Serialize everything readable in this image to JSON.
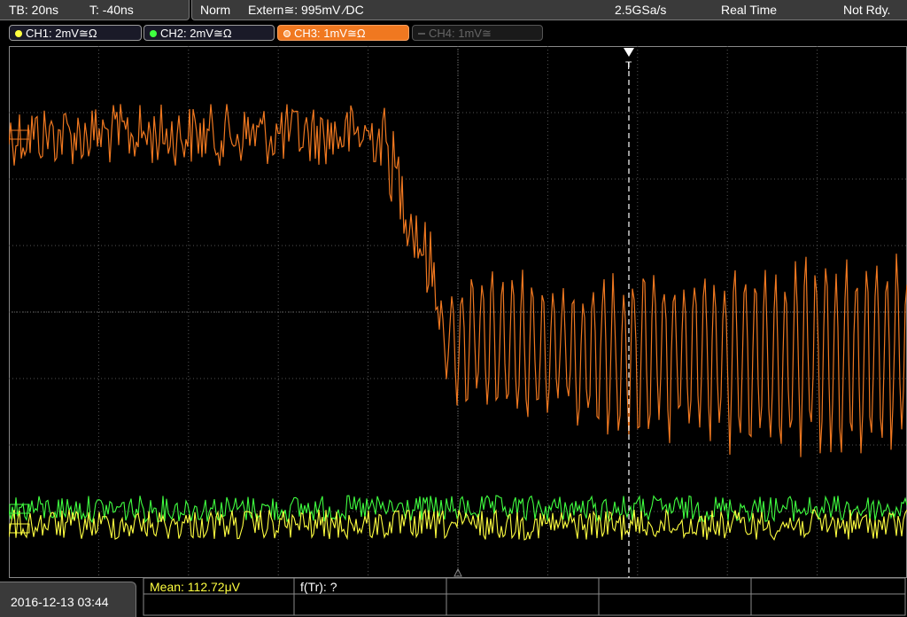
{
  "header": {
    "timebase": "TB: 20ns",
    "trigger_time": "T: -40ns",
    "mode": "Norm",
    "trigger": "Extern≅: 995mV ⁄DC",
    "sample_rate": "2.5GSa/s",
    "acq_mode": "Real Time",
    "status": "Not Rdy."
  },
  "channels": [
    {
      "label": "CH1: 2mV≅Ω",
      "color": "#ffff40",
      "active": true
    },
    {
      "label": "CH2: 2mV≅Ω",
      "color": "#40ff40",
      "active": true
    },
    {
      "label": "CH3: 1mV≅Ω",
      "color": "#f07820",
      "active": true
    },
    {
      "label": "CH4: 1mV≅",
      "color": "#666666",
      "active": false
    }
  ],
  "measurements": {
    "mean": "Mean: 112.72μV",
    "rise": "f(Tr): ?"
  },
  "datetime": "2016-12-13 03:44",
  "colors": {
    "ch1": "#ffff40",
    "ch2": "#40ff40",
    "ch3": "#f07820",
    "grid": "#555555",
    "cursor": "#ffffff"
  }
}
